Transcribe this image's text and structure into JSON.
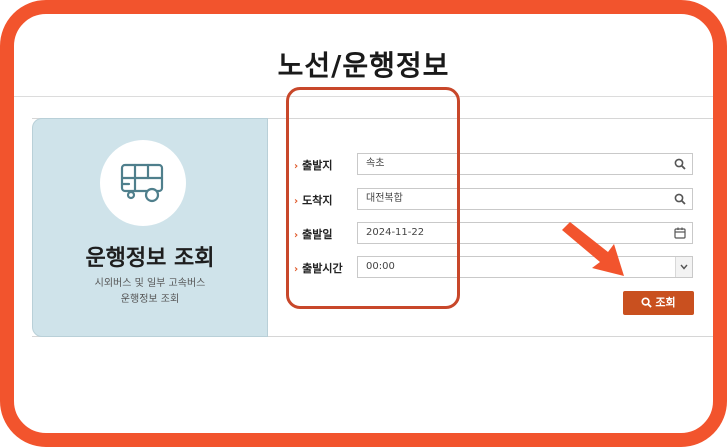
{
  "page_title": "노선/운행정보",
  "card": {
    "icon": "bus-icon",
    "title": "운행정보 조회",
    "desc_line1": "시외버스 및 일부 고속버스",
    "desc_line2": "운행정보 조회"
  },
  "form": {
    "departure": {
      "label": "출발지",
      "value": "속초",
      "icon": "search-icon"
    },
    "arrival": {
      "label": "도착지",
      "value": "대전복합",
      "icon": "search-icon"
    },
    "date": {
      "label": "출발일",
      "value": "2024-11-22",
      "icon": "calendar-icon"
    },
    "time": {
      "label": "출발시간",
      "value": "00:00",
      "icon": "chevron-down-icon"
    }
  },
  "search_button": {
    "label": "조회",
    "icon": "search-icon"
  },
  "colors": {
    "frame": "#f2542d",
    "accent": "#c9501f",
    "card_bg": "#cfe3ea",
    "highlight": "#c8472a"
  }
}
